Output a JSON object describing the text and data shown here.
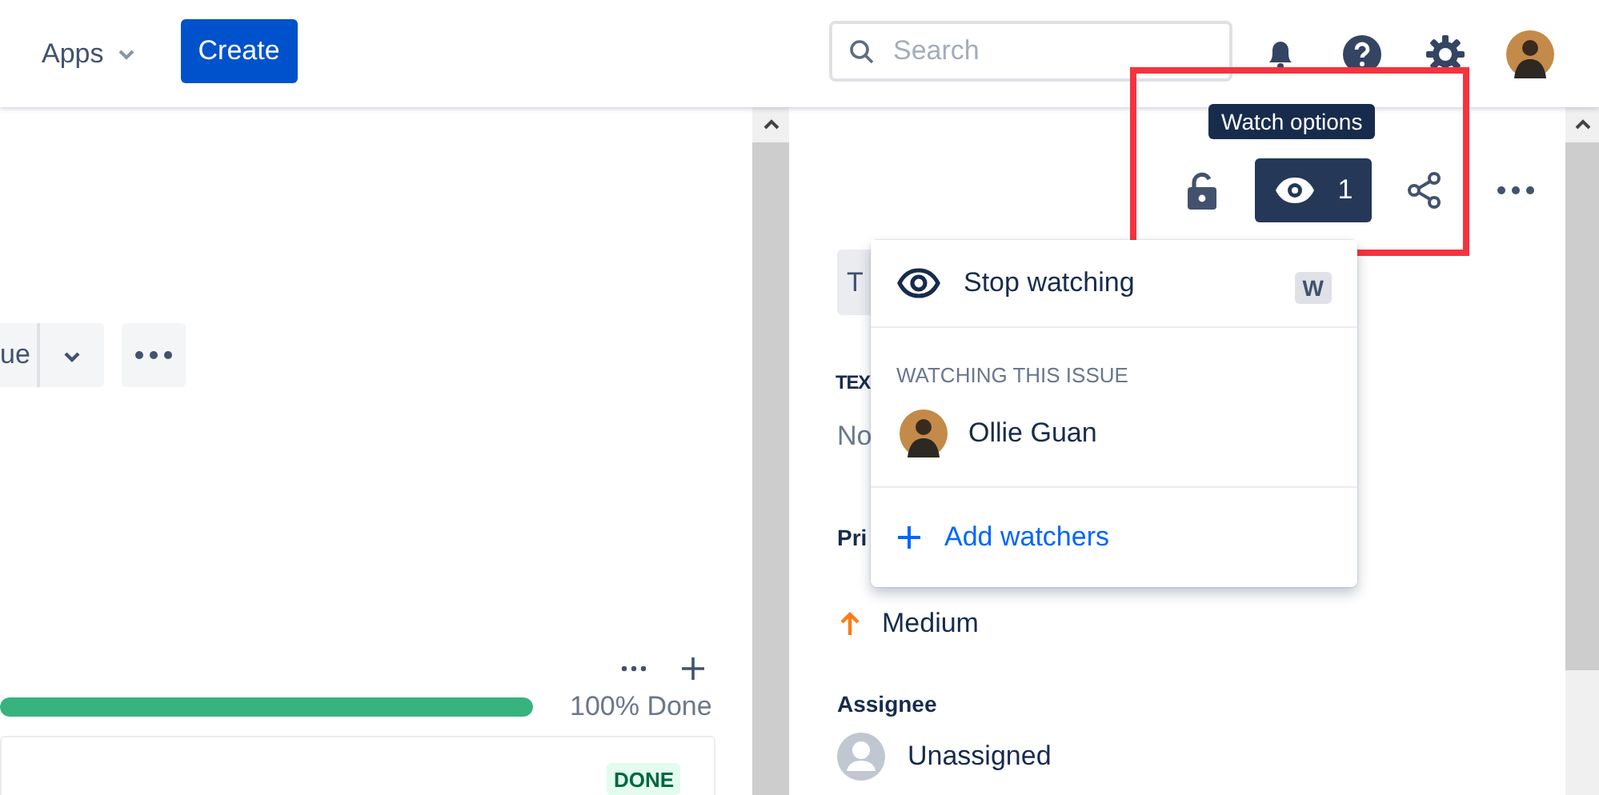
{
  "header": {
    "apps_menu": "Apps",
    "create_button": "Create",
    "search": {
      "placeholder": "Search"
    }
  },
  "left_panel": {
    "action_button": "ue",
    "progress": {
      "level": 1.0,
      "reading": "100% Done"
    },
    "status_lozenge": "DONE"
  },
  "issue_toolbar": {
    "tooltip": "Watch options",
    "watch_count": "1",
    "watching": true
  },
  "watch_menu": {
    "stop_watching": "Stop watching",
    "shortcut": "W",
    "section_title": "WATCHING THIS ISSUE",
    "watchers": [
      {
        "name": "Ollie Guan"
      }
    ],
    "add_watchers": "Add watchers"
  },
  "details": {
    "type_button": "T",
    "field_label": "TEX",
    "field_value": "No",
    "priority_label": "Pri",
    "priority_value": "Medium",
    "assignee_label": "Assignee",
    "assignee_value": "Unassigned"
  }
}
